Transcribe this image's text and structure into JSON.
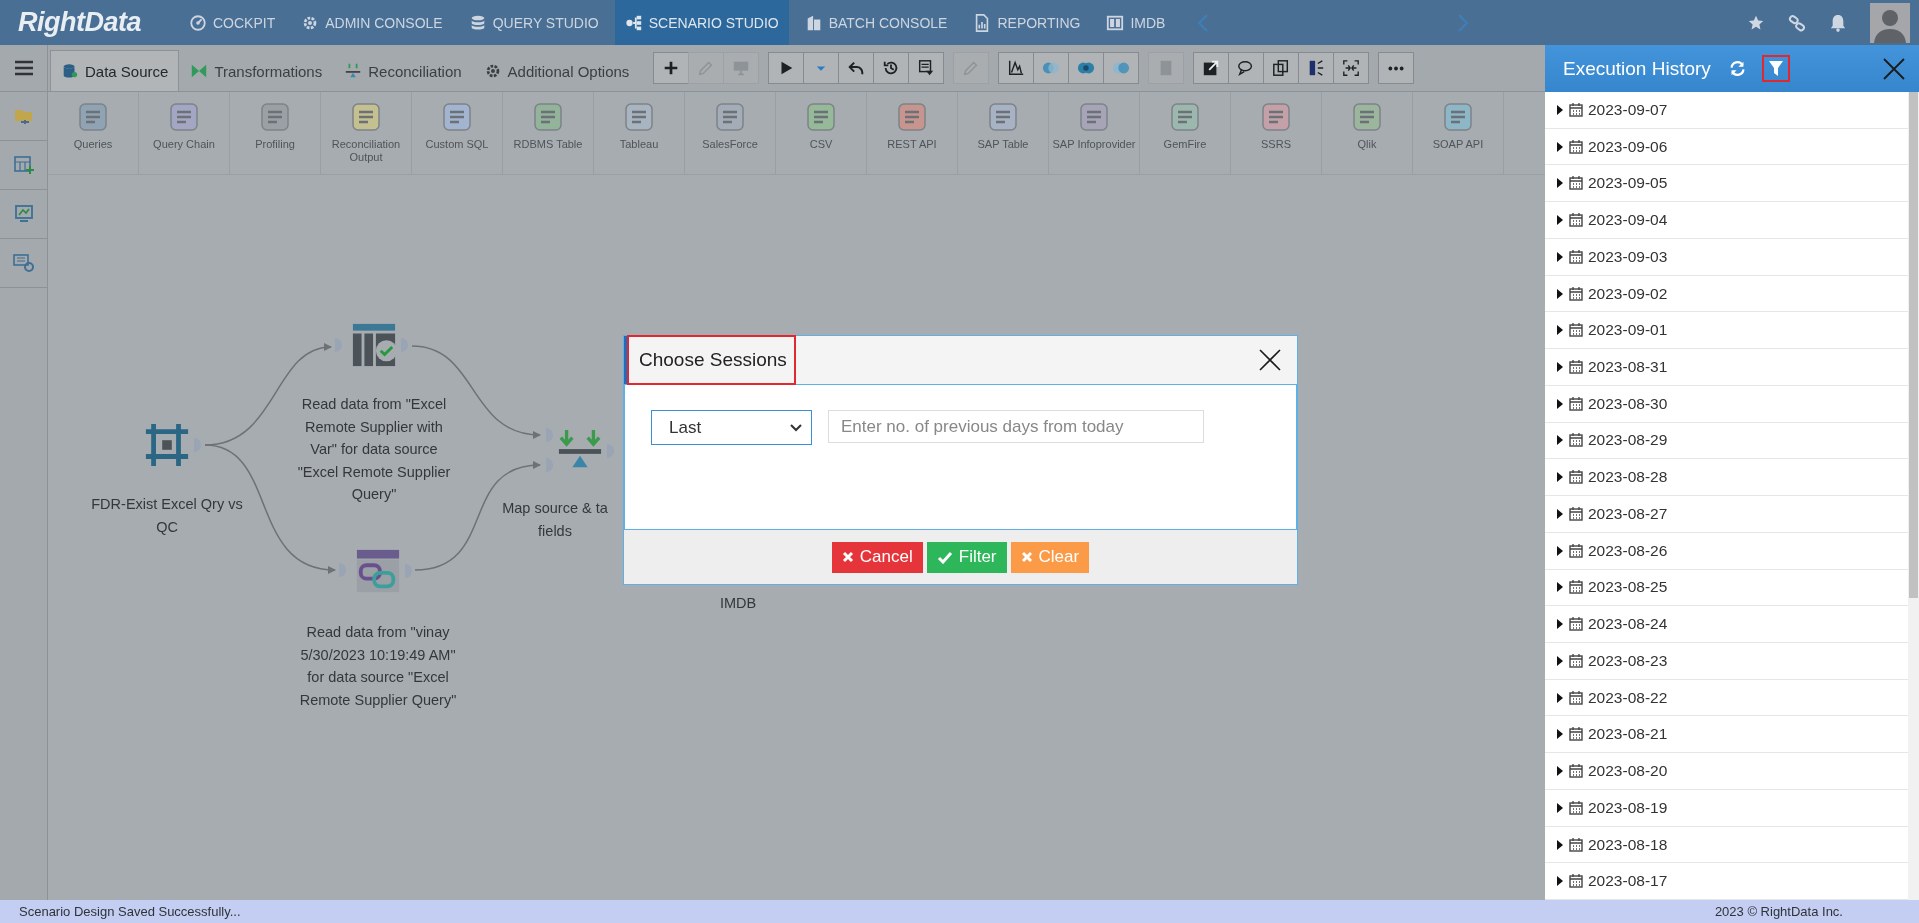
{
  "nav": {
    "logo": "RightData",
    "items": [
      {
        "label": "COCKPIT",
        "selected": false
      },
      {
        "label": "ADMIN CONSOLE",
        "selected": false
      },
      {
        "label": "QUERY STUDIO",
        "selected": false
      },
      {
        "label": "SCENARIO STUDIO",
        "selected": true
      },
      {
        "label": "BATCH CONSOLE",
        "selected": false
      },
      {
        "label": "REPORTING",
        "selected": false
      },
      {
        "label": "IMDB",
        "selected": false
      }
    ]
  },
  "tabs": [
    {
      "label": "Data Source",
      "selected": true
    },
    {
      "label": "Transformations",
      "selected": false
    },
    {
      "label": "Reconciliation",
      "selected": false
    },
    {
      "label": "Additional Options",
      "selected": false
    }
  ],
  "toolbar": [
    {
      "buttons": [
        {
          "disabled": false
        },
        {
          "disabled": true
        },
        {
          "disabled": true
        }
      ]
    },
    {
      "buttons": [
        {
          "disabled": false
        },
        {
          "disabled": false
        },
        {
          "disabled": false
        },
        {
          "disabled": false
        },
        {
          "disabled": false
        }
      ]
    },
    {
      "buttons": [
        {
          "disabled": true
        }
      ]
    },
    {
      "buttons": [
        {
          "disabled": false
        },
        {
          "disabled": false
        },
        {
          "disabled": false
        },
        {
          "disabled": false
        }
      ]
    },
    {
      "buttons": [
        {
          "disabled": true
        }
      ]
    },
    {
      "buttons": [
        {
          "disabled": false
        },
        {
          "disabled": false
        },
        {
          "disabled": false
        },
        {
          "disabled": false
        },
        {
          "disabled": false
        }
      ]
    },
    {
      "buttons": [
        {
          "disabled": false
        }
      ]
    }
  ],
  "palette": [
    {
      "label": "Queries"
    },
    {
      "label": "Query Chain"
    },
    {
      "label": "Profiling"
    },
    {
      "label": "Reconciliation Output"
    },
    {
      "label": "Custom SQL"
    },
    {
      "label": "RDBMS Table"
    },
    {
      "label": "Tableau"
    },
    {
      "label": "SalesForce"
    },
    {
      "label": "CSV"
    },
    {
      "label": "REST API"
    },
    {
      "label": "SAP Table"
    },
    {
      "label": "SAP Infoprovider"
    },
    {
      "label": "GemFire"
    },
    {
      "label": "SSRS"
    },
    {
      "label": "Qlik"
    },
    {
      "label": "SOAP API"
    }
  ],
  "canvas": {
    "nodes": [
      {
        "label": "FDR-Exist Excel Qry vs QC"
      },
      {
        "label": "Read data from \"Excel Remote Supplier with Var\" for data source \"Excel Remote Supplier Query\""
      },
      {
        "label": "Read data from \"vinay 5/30/2023 10:19:49 AM\" for data source \"Excel Remote Supplier Query\""
      },
      {
        "label": "Map source & ta fields"
      },
      {
        "label": "IMDB"
      }
    ]
  },
  "dialog": {
    "title": "Choose Sessions",
    "title_highlighted": true,
    "select_value": "Last",
    "input_placeholder": "Enter no. of previous days from today",
    "buttons": [
      {
        "label": "Cancel",
        "kind": "cancel"
      },
      {
        "label": "Filter",
        "kind": "filter"
      },
      {
        "label": "Clear",
        "kind": "clear"
      }
    ]
  },
  "history": {
    "title": "Execution History",
    "filter_highlighted": true,
    "items": [
      {
        "date": "2023-09-07",
        "expanded": false
      },
      {
        "date": "2023-09-06",
        "expanded": false
      },
      {
        "date": "2023-09-05",
        "expanded": false
      },
      {
        "date": "2023-09-04",
        "expanded": false
      },
      {
        "date": "2023-09-03",
        "expanded": false
      },
      {
        "date": "2023-09-02",
        "expanded": false
      },
      {
        "date": "2023-09-01",
        "expanded": false
      },
      {
        "date": "2023-08-31",
        "expanded": false
      },
      {
        "date": "2023-08-30",
        "expanded": false
      },
      {
        "date": "2023-08-29",
        "expanded": false
      },
      {
        "date": "2023-08-28",
        "expanded": false
      },
      {
        "date": "2023-08-27",
        "expanded": false
      },
      {
        "date": "2023-08-26",
        "expanded": false
      },
      {
        "date": "2023-08-25",
        "expanded": false
      },
      {
        "date": "2023-08-24",
        "expanded": false
      },
      {
        "date": "2023-08-23",
        "expanded": false
      },
      {
        "date": "2023-08-22",
        "expanded": false
      },
      {
        "date": "2023-08-21",
        "expanded": false
      },
      {
        "date": "2023-08-20",
        "expanded": false
      },
      {
        "date": "2023-08-19",
        "expanded": false
      },
      {
        "date": "2023-08-18",
        "expanded": false
      },
      {
        "date": "2023-08-17",
        "expanded": false
      }
    ]
  },
  "status_bar": {
    "message": "Scenario Design Saved Successfully...",
    "copyright": "2023 © RightData Inc."
  }
}
